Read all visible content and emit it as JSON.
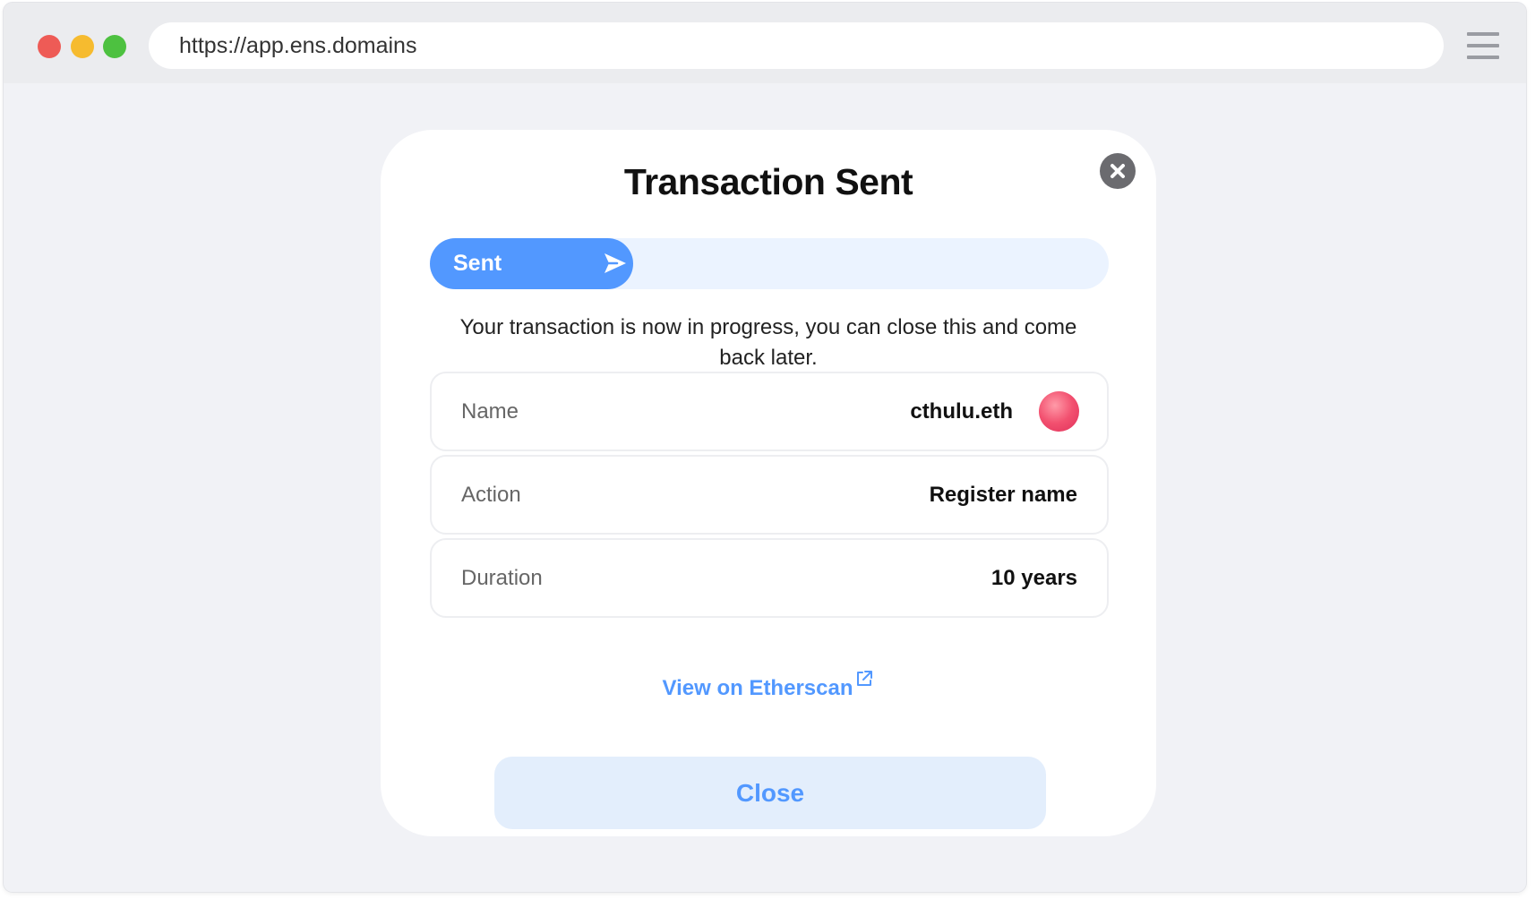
{
  "browser": {
    "url": "https://app.ens.domains",
    "menu_icon": "hamburger-menu-icon"
  },
  "modal": {
    "title": "Transaction Sent",
    "close_icon": "close-icon",
    "progress": {
      "label": "Sent",
      "icon": "send-icon",
      "fraction": 0.3,
      "fill_color": "#5298ff",
      "track_color": "#ebf3ff"
    },
    "message": "Your transaction is now in progress, you can close this and come back later.",
    "details": [
      {
        "label": "Name",
        "value": "cthulu.eth",
        "avatar": true
      },
      {
        "label": "Action",
        "value": "Register name",
        "avatar": false
      },
      {
        "label": "Duration",
        "value": "10 years",
        "avatar": false
      }
    ],
    "etherscan_link": "View on Etherscan",
    "etherscan_icon": "external-link-icon",
    "close_button": "Close"
  },
  "colors": {
    "accent": "#5298ff",
    "avatar": "#f2506f"
  }
}
